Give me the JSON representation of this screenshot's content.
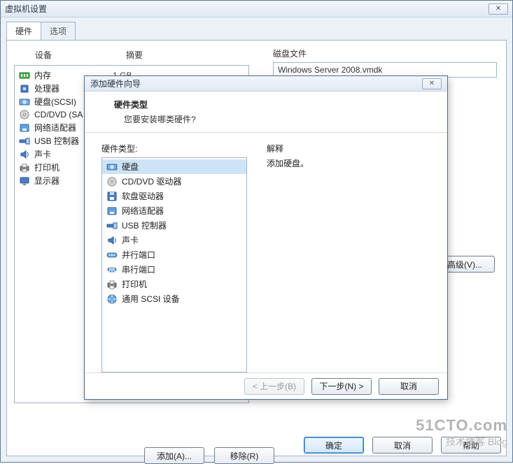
{
  "outer": {
    "title": "虚拟机设置",
    "close_glyph": "✕",
    "tabs": {
      "hardware": "硬件",
      "options": "选项"
    },
    "columns": {
      "device": "设备",
      "summary": "摘要"
    },
    "hw": [
      {
        "icon": "memory-icon",
        "name": "内存",
        "summary": "1 GB"
      },
      {
        "icon": "cpu-icon",
        "name": "处理器",
        "summary": ""
      },
      {
        "icon": "disk-icon",
        "name": "硬盘(SCSI)",
        "summary": ""
      },
      {
        "icon": "cd-icon",
        "name": "CD/DVD (SA",
        "summary": ""
      },
      {
        "icon": "nic-icon",
        "name": "网络适配器",
        "summary": ""
      },
      {
        "icon": "usb-icon",
        "name": "USB 控制器",
        "summary": ""
      },
      {
        "icon": "sound-icon",
        "name": "声卡",
        "summary": ""
      },
      {
        "icon": "printer-icon",
        "name": "打印机",
        "summary": ""
      },
      {
        "icon": "display-icon",
        "name": "显示器",
        "summary": ""
      }
    ],
    "diskfile_label": "磁盘文件",
    "diskfile_value": "Windows Server 2008.vmdk",
    "advanced_btn": "高级(V)...",
    "add_btn": "添加(A)...",
    "remove_btn": "移除(R)",
    "ok_btn": "确定",
    "cancel_btn": "取消",
    "help_btn": "帮助"
  },
  "wizard": {
    "title": "添加硬件向导",
    "close_glyph": "✕",
    "heading": "硬件类型",
    "subheading": "您要安装哪类硬件?",
    "list_label": "硬件类型:",
    "explain_label": "解释",
    "explain_body": "添加硬盘。",
    "types": [
      {
        "icon": "disk-icon",
        "label": "硬盘"
      },
      {
        "icon": "cd-icon",
        "label": "CD/DVD 驱动器"
      },
      {
        "icon": "floppy-icon",
        "label": "软盘驱动器"
      },
      {
        "icon": "nic-icon",
        "label": "网络适配器"
      },
      {
        "icon": "usb-icon",
        "label": "USB 控制器"
      },
      {
        "icon": "sound-icon",
        "label": "声卡"
      },
      {
        "icon": "parallel-icon",
        "label": "并行端口"
      },
      {
        "icon": "serial-icon",
        "label": "串行端口"
      },
      {
        "icon": "printer-icon",
        "label": "打印机"
      },
      {
        "icon": "scsi-icon",
        "label": "通用 SCSI 设备"
      }
    ],
    "back_btn": "< 上一步(B)",
    "next_btn": "下一步(N) >",
    "cancel_btn": "取消"
  },
  "watermark": {
    "line1": "51CTO.com",
    "line2": "技术博客   Blog"
  }
}
